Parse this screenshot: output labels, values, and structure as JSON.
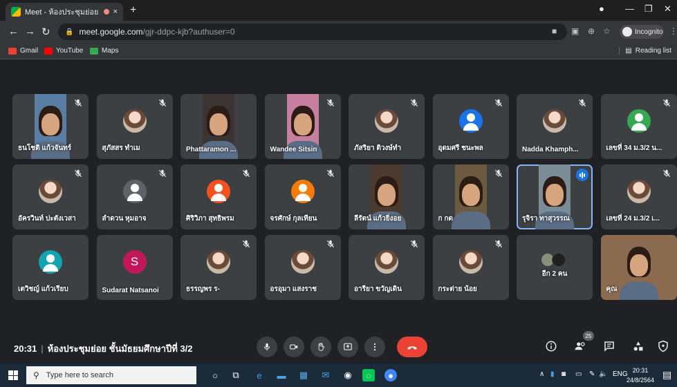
{
  "browser": {
    "tab_title": "Meet - ห้องประชุมย่อย ชั้นมัธยม",
    "tab_close": "×",
    "new_tab": "+",
    "address_host": "meet.google.com",
    "address_path": "/gjr-ddpc-kjb?authuser=0",
    "incognito_label": "Incognito",
    "bookmarks": [
      {
        "label": "Gmail",
        "color": "#ea4335"
      },
      {
        "label": "YouTube",
        "color": "#ff0000"
      },
      {
        "label": "Maps",
        "color": "#34a853"
      }
    ],
    "reading_list": "Reading list"
  },
  "tiles": [
    {
      "name": "ธนโชติ แก้วจันทร์",
      "kind": "video",
      "bg": "#5a7ea3",
      "muted": true
    },
    {
      "name": "สุภัสสร ทำเม",
      "kind": "photo",
      "muted": true
    },
    {
      "name": "Phattaramon ...",
      "kind": "video",
      "bg": "#3a3432",
      "muted": false
    },
    {
      "name": "Wandee Sitsin",
      "kind": "video",
      "bg": "#c77fa0",
      "muted": true
    },
    {
      "name": "ภัสริยา ติวงษ์ทำ",
      "kind": "photo",
      "muted": true
    },
    {
      "name": "อุดมศรี ชนะพล",
      "kind": "person",
      "color": "#1a73e8",
      "muted": true
    },
    {
      "name": "Nadda Khamph...",
      "kind": "photo",
      "muted": true
    },
    {
      "name": "เลขที่ 34 ม.3/2 น...",
      "kind": "person",
      "color": "#34a853",
      "muted": true
    },
    {
      "name": "อัครวินท์ ปะตังเวสา",
      "kind": "photo",
      "muted": true
    },
    {
      "name": "ลำดวน หุมอาจ",
      "kind": "person",
      "color": "#5f6368",
      "muted": true
    },
    {
      "name": "ศิริวิภา สุทธิพรม",
      "kind": "person",
      "color": "#f4511e",
      "muted": true
    },
    {
      "name": "จรศักษ์ กุลเทียน",
      "kind": "person",
      "color": "#f57c00",
      "muted": true
    },
    {
      "name": "ลีรัตน์ แก้วยิ่งอย",
      "kind": "video",
      "bg": "#4a3a30",
      "muted": false
    },
    {
      "name": "ก กด",
      "kind": "video",
      "bg": "#6b5a40",
      "muted": true
    },
    {
      "name": "รุจิรา ทาสุวรรณ",
      "kind": "video",
      "bg": "#7a8c98",
      "muted": false,
      "speaking": true
    },
    {
      "name": "เลขที่ 24 ม.3/2 เ...",
      "kind": "photo",
      "muted": true
    },
    {
      "name": "เตวิชญ์ แก้วเรียบ",
      "kind": "person",
      "color": "#12a4af",
      "muted": false
    },
    {
      "name": "Sudarat Natsanoi",
      "kind": "letter",
      "letter": "S",
      "color": "#c2185b",
      "muted": false
    },
    {
      "name": "ธรรญพร ร-",
      "kind": "photo",
      "muted": true
    },
    {
      "name": "อรอุมา แสงราช",
      "kind": "photo",
      "muted": true
    },
    {
      "name": "อารียา ขวัญเดิน",
      "kind": "photo",
      "muted": true
    },
    {
      "name": "กระต่าย น้อย",
      "kind": "photo",
      "muted": true
    },
    {
      "name": "อีก 2 คน",
      "kind": "more",
      "muted": false
    },
    {
      "name": "คุณ",
      "kind": "video",
      "bg": "#8b6b4f",
      "muted": false
    }
  ],
  "bottom_bar": {
    "time": "20:31",
    "separator": "|",
    "meeting_name": "ห้องประชุมย่อย ชั้นมัธยมศึกษาปีที่ 3/2",
    "participant_count": "25"
  },
  "taskbar": {
    "search_placeholder": "Type here to search",
    "lang": "ENG",
    "clock_time": "20:31",
    "clock_date": "24/8/2564"
  }
}
